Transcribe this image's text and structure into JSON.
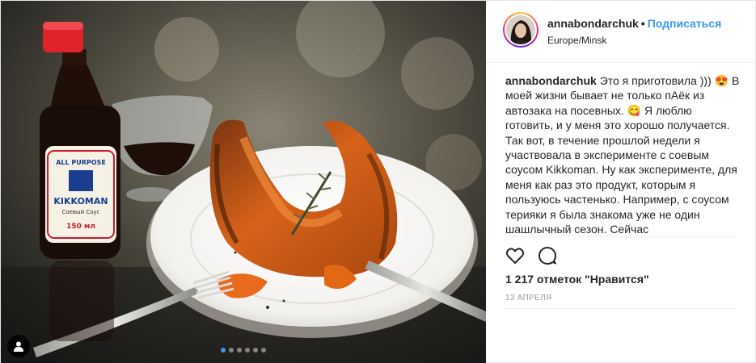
{
  "media": {
    "slide_count": 6,
    "active_slide": 1,
    "bottle_label": {
      "top": "ALL PURPOSE",
      "brand": "KIKKOMAN",
      "sub": "Соевый Соус",
      "volume": "150 мл"
    }
  },
  "header": {
    "username": "annabondarchuk",
    "separator": "•",
    "follow_label": "Подписаться",
    "location": "Europe/Minsk"
  },
  "caption": {
    "username": "annabondarchuk",
    "text": "Это я приготовила ))) 😍 В моей жизни бывает не только пАёк из автозака на посевных. 😋 Я люблю готовить, и у меня это хорошо получается. Так вот, в течение прошлой недели я участвовала в эксперименте с соевым соусом Kikkoman. Ну как эксперименте, для меня как раз это продукт, которым я пользуюсь частенько. Например, с соусом терияки я была знакома уже не один шашлычный сезон. Сейчас"
  },
  "actions": {
    "likes": "1 217 отметок \"Нравится\"",
    "date": "13 АПРЕЛЯ"
  },
  "icons": {
    "like": "heart-icon",
    "comment": "comment-icon",
    "tagged_user": "user-tag-icon"
  },
  "colors": {
    "link": "#3897f0",
    "text": "#262626",
    "muted": "#999999",
    "divider": "#efefef"
  }
}
